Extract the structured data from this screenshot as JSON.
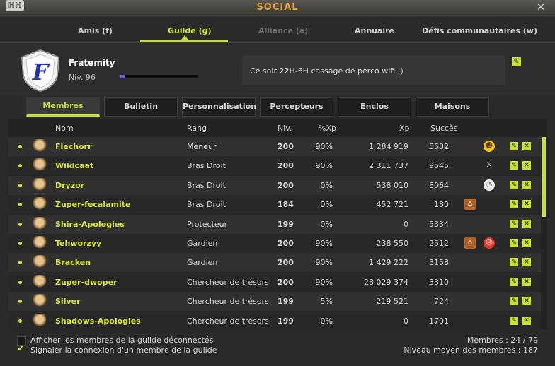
{
  "window": {
    "title": "SOCIAL",
    "close_label": "✕",
    "emblem_glyph": "ℍℍ"
  },
  "top_tabs": [
    {
      "label": "Amis (f)",
      "state": "normal"
    },
    {
      "label": "Guilde (g)",
      "state": "active"
    },
    {
      "label": "Alliance (a)",
      "state": "disabled"
    },
    {
      "label": "Annuaire",
      "state": "normal"
    },
    {
      "label": "Défis communautaires (w)",
      "state": "normal"
    }
  ],
  "guild": {
    "name": "Fratemity",
    "level": "Niv. 96",
    "xp_fraction": 0.05,
    "emblem_letter": "F",
    "message": "Ce soir 22H-6H cassage de perco wifi ;)"
  },
  "sub_tabs": [
    "Membres",
    "Bulletin",
    "Personnalisation",
    "Percepteurs",
    "Enclos",
    "Maisons"
  ],
  "columns": {
    "name": "Nom",
    "rank": "Rang",
    "level": "Niv.",
    "xp_pct": "%Xp",
    "xp": "Xp",
    "success": "Succès"
  },
  "members": [
    {
      "name": "Flechorr",
      "rank": "Meneur",
      "level": "200",
      "xp_pct": "90%",
      "xp": "1 284 919",
      "success": "5682",
      "house": false,
      "emote": "smile"
    },
    {
      "name": "Wildcaat",
      "rank": "Bras Droit",
      "level": "200",
      "xp_pct": "90%",
      "xp": "2 311 737",
      "success": "9545",
      "house": false,
      "emote": "sword"
    },
    {
      "name": "Dryzor",
      "rank": "Bras Droit",
      "level": "200",
      "xp_pct": "0%",
      "xp": "538 010",
      "success": "8064",
      "house": false,
      "emote": "bandage"
    },
    {
      "name": "Zuper-fecalamite",
      "rank": "Bras Droit",
      "level": "184",
      "xp_pct": "0%",
      "xp": "452 721",
      "success": "180",
      "house": true,
      "emote": ""
    },
    {
      "name": "Shira-Apologies",
      "rank": "Protecteur",
      "level": "199",
      "xp_pct": "0%",
      "xp": "0",
      "success": "5334",
      "house": false,
      "emote": ""
    },
    {
      "name": "Tehworzyy",
      "rank": "Gardien",
      "level": "200",
      "xp_pct": "90%",
      "xp": "238 550",
      "success": "2512",
      "house": true,
      "emote": "angry"
    },
    {
      "name": "Bracken",
      "rank": "Gardien",
      "level": "200",
      "xp_pct": "90%",
      "xp": "1 429 222",
      "success": "3158",
      "house": false,
      "emote": ""
    },
    {
      "name": "Zuper-dwoper",
      "rank": "Chercheur de trésors",
      "level": "200",
      "xp_pct": "90%",
      "xp": "28 029 374",
      "success": "3310",
      "house": false,
      "emote": ""
    },
    {
      "name": "Silver",
      "rank": "Chercheur de trésors",
      "level": "199",
      "xp_pct": "5%",
      "xp": "219 521",
      "success": "724",
      "house": false,
      "emote": ""
    },
    {
      "name": "Shadows-Apologies",
      "rank": "Chercheur de trésors",
      "level": "199",
      "xp_pct": "0%",
      "xp": "0",
      "success": "1701",
      "house": false,
      "emote": ""
    }
  ],
  "footer": {
    "show_offline_label": "Afficher les membres de la guilde déconnectés",
    "show_offline_checked": false,
    "notify_label": "Signaler la connexion d'un membre de la guilde",
    "notify_checked": true,
    "members_count": "Membres : 24 / 79",
    "avg_level": "Niveau moyen des membres : 187"
  },
  "colors": {
    "accent": "#c8e035",
    "title": "#e9a53a"
  }
}
